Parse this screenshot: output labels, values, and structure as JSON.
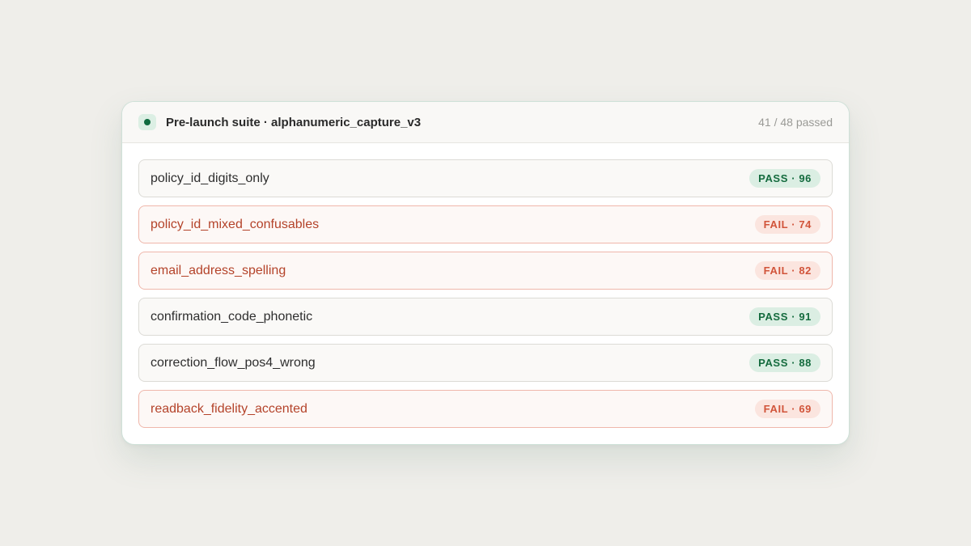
{
  "suite": {
    "title": "Pre-launch suite · alphanumeric_capture_v3",
    "summary": "41 / 48 passed",
    "status_icon": "status-dot-icon",
    "accent_color": "#0f6b3f"
  },
  "tests": [
    {
      "name": "policy_id_digits_only",
      "status": "pass",
      "badge": "PASS · 96",
      "score": 96
    },
    {
      "name": "policy_id_mixed_confusables",
      "status": "fail",
      "badge": "FAIL · 74",
      "score": 74
    },
    {
      "name": "email_address_spelling",
      "status": "fail",
      "badge": "FAIL · 82",
      "score": 82
    },
    {
      "name": "confirmation_code_phonetic",
      "status": "pass",
      "badge": "PASS · 91",
      "score": 91
    },
    {
      "name": "correction_flow_pos4_wrong",
      "status": "pass",
      "badge": "PASS · 88",
      "score": 88
    },
    {
      "name": "readback_fidelity_accented",
      "status": "fail",
      "badge": "FAIL · 69",
      "score": 69
    }
  ],
  "colors": {
    "pass": "#146b3e",
    "fail": "#d1543a",
    "fail_text": "#b4432a"
  }
}
